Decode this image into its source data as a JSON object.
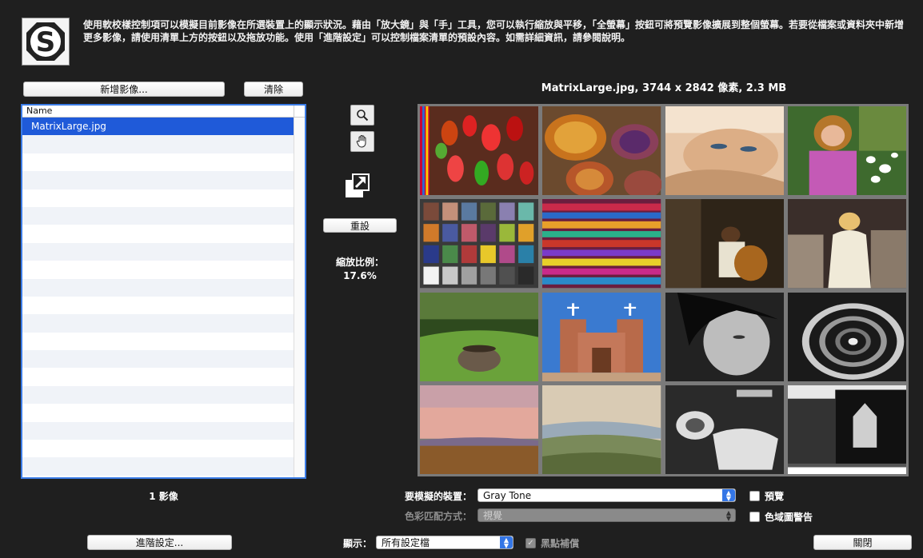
{
  "logo": {
    "letter": "S"
  },
  "description": "使用軟校樣控制項可以模擬目前影像在所選裝置上的顯示狀況。藉由「放大鏡」與「手」工具，您可以執行縮放與平移，「全螢幕」按鈕可將預覽影像擴展到整個螢幕。若要從檔案或資料夾中新增更多影像，請使用清單上方的按鈕以及拖放功能。使用「進階設定」可以控制檔案清單的預設內容。如需詳細資訊，請參閱說明。",
  "buttons": {
    "add_images": "新增影像...",
    "clear": "清除",
    "reset": "重設",
    "advanced": "進階設定...",
    "close": "關閉"
  },
  "file_list": {
    "column_header": "Name",
    "items": [
      "MatrixLarge.jpg"
    ],
    "count_label": "1 影像"
  },
  "tools": {
    "zoom_icon": "magnifier-icon",
    "hand_icon": "hand-icon",
    "fullscreen_icon": "fullscreen-icon"
  },
  "zoom": {
    "label": "縮放比例：",
    "value": "17.6%"
  },
  "image_info": "MatrixLarge.jpg, 3744 x 2842 像素, 2.3 MB",
  "controls": {
    "device_label": "要模擬的裝置：",
    "device_value": "Gray Tone",
    "matching_label": "色彩匹配方式：",
    "matching_value": "視覺",
    "display_label": "顯示：",
    "display_value": "所有設定檔",
    "preview_label": "預覽",
    "gamut_label": "色域圖警告",
    "bpc_label": "黑點補償"
  },
  "colors": {
    "accent": "#3476e6",
    "selection": "#1f5ad9",
    "background": "#1f1f1f"
  }
}
